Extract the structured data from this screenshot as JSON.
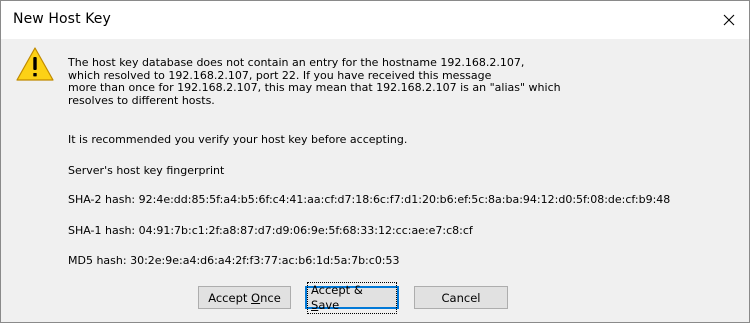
{
  "window": {
    "title": "New Host Key"
  },
  "icons": {
    "warning": "warning-icon",
    "close": "close-icon"
  },
  "message": {
    "lines": [
      "The host key database does not contain an entry for the hostname 192.168.2.107,",
      "which resolved to 192.168.2.107, port 22.  If you have received this message",
      "more than once for 192.168.2.107, this may mean that 192.168.2.107 is an \"alias\" which",
      "resolves to different hosts."
    ],
    "recommendation": "It is recommended you verify your host key before accepting.",
    "fingerprint_heading": "Server's host key fingerprint",
    "sha2": "SHA-2 hash: 92:4e:dd:85:5f:a4:b5:6f:c4:41:aa:cf:d7:18:6c:f7:d1:20:b6:ef:5c:8a:ba:94:12:d0:5f:08:de:cf:b9:48",
    "sha1": "SHA-1 hash: 04:91:7b:c1:2f:a8:87:d7:d9:06:9e:5f:68:33:12:cc:ae:e7:c8:cf",
    "md5": "MD5 hash: 30:2e:9e:a4:d6:a4:2f:f3:77:ac:b6:1d:5a:7b:c0:53"
  },
  "buttons": {
    "accept_once": {
      "before": "Accept ",
      "mnemonic": "O",
      "after": "nce"
    },
    "accept_save": {
      "before": "Accept & ",
      "mnemonic": "S",
      "after": "ave"
    },
    "cancel": "Cancel"
  },
  "colors": {
    "dialog_background": "#f0f0f0",
    "titlebar_background": "#ffffff",
    "button_face": "#e1e1e1",
    "default_button_border": "#0078d7",
    "warning_yellow": "#fcd116"
  }
}
